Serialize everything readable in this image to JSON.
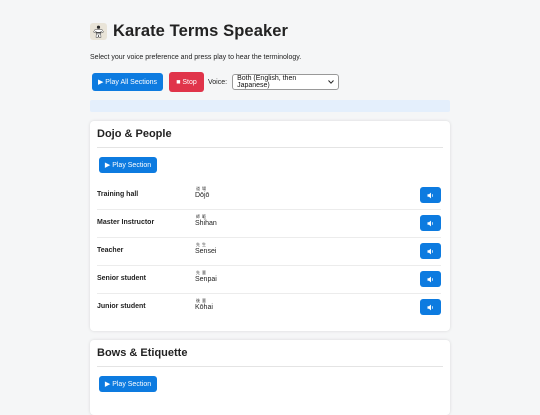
{
  "app": {
    "title": "Karate Terms Speaker",
    "subtitle": "Select your voice preference and press play to hear the terminology."
  },
  "controls": {
    "play_all_label": "▶ Play All Sections",
    "stop_label": "■ Stop",
    "voice_label": "Voice:",
    "voice_selected": "Both (English, then Japanese)"
  },
  "status_text": "",
  "sections": [
    {
      "title": "Dojo & People",
      "play_label": "▶ Play Section",
      "terms": [
        {
          "english": "Training hall",
          "kanji": "道場",
          "romaji": "Dōjō"
        },
        {
          "english": "Master Instructor",
          "kanji": "師範",
          "romaji": "Shihan"
        },
        {
          "english": "Teacher",
          "kanji": "先生",
          "romaji": "Sensei"
        },
        {
          "english": "Senior student",
          "kanji": "先輩",
          "romaji": "Senpai"
        },
        {
          "english": "Junior student",
          "kanji": "後輩",
          "romaji": "Kōhai"
        }
      ]
    },
    {
      "title": "Bows & Etiquette",
      "play_label": "▶ Play Section",
      "terms": []
    }
  ],
  "icons": {
    "title_icon": "karate-gi-icon",
    "speak_icon": "speaker-icon",
    "select_icon": "chevron-down-icon"
  },
  "colors": {
    "primary": "#0d7be0",
    "stop": "#e0344a",
    "status_bg": "#e4effc"
  }
}
